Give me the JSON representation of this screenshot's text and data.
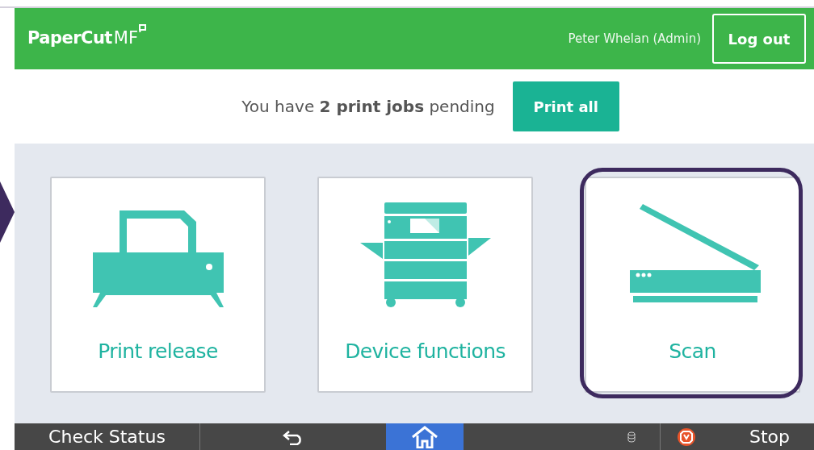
{
  "header": {
    "logo": "PaperCut",
    "logo_suffix": "MF",
    "user": "Peter Whelan (Admin)",
    "logout": "Log out"
  },
  "pending": {
    "message": "You have **2 print jobs** pending",
    "button": "Print all"
  },
  "tiles": [
    {
      "kind": "printer",
      "label": "Print release",
      "selected": false
    },
    {
      "kind": "copier",
      "label": "Device functions",
      "selected": false
    },
    {
      "kind": "scanner",
      "label": "Scan",
      "selected": true
    }
  ],
  "bottom_bar": {
    "check_status": "Check Status",
    "stop": "Stop",
    "home_selected": true
  }
}
